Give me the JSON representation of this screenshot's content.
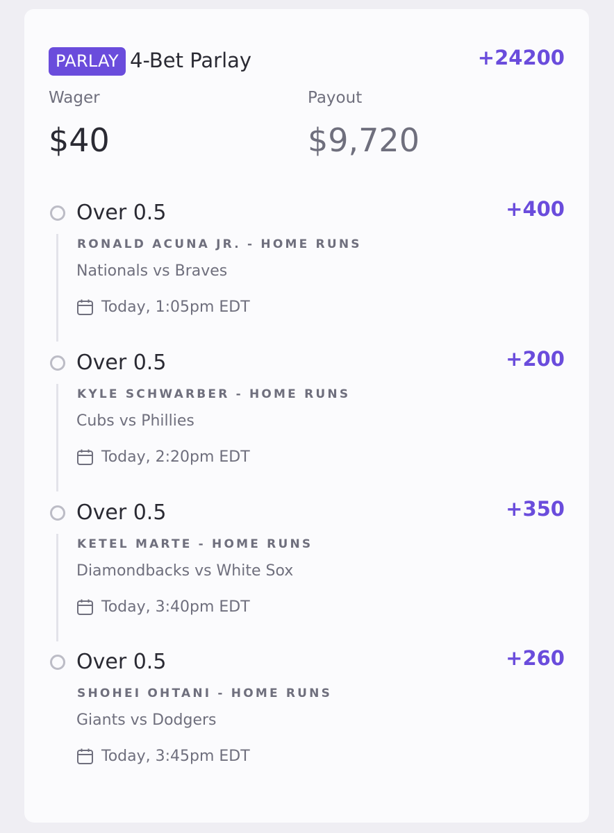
{
  "parlay": {
    "badge": "PARLAY",
    "title": "4-Bet Parlay",
    "odds": "+24200",
    "wager_label": "Wager",
    "wager_value": "$40",
    "payout_label": "Payout",
    "payout_value": "$9,720"
  },
  "legs": [
    {
      "selection": "Over 0.5",
      "odds": "+400",
      "market": "RONALD ACUNA JR. - HOME RUNS",
      "game": "Nationals vs Braves",
      "time": "Today, 1:05pm EDT"
    },
    {
      "selection": "Over 0.5",
      "odds": "+200",
      "market": "KYLE SCHWARBER - HOME RUNS",
      "game": "Cubs vs Phillies",
      "time": "Today, 2:20pm EDT"
    },
    {
      "selection": "Over 0.5",
      "odds": "+350",
      "market": "KETEL MARTE - HOME RUNS",
      "game": "Diamondbacks vs White Sox",
      "time": "Today, 3:40pm EDT"
    },
    {
      "selection": "Over 0.5",
      "odds": "+260",
      "market": "SHOHEI OHTANI - HOME RUNS",
      "game": "Giants vs Dodgers",
      "time": "Today, 3:45pm EDT"
    }
  ],
  "colors": {
    "accent": "#6a4cdc",
    "text_primary": "#2a2a33",
    "text_secondary": "#6f6f7d"
  },
  "icons": {
    "status": "circle-outline-icon",
    "date": "calendar-icon"
  }
}
